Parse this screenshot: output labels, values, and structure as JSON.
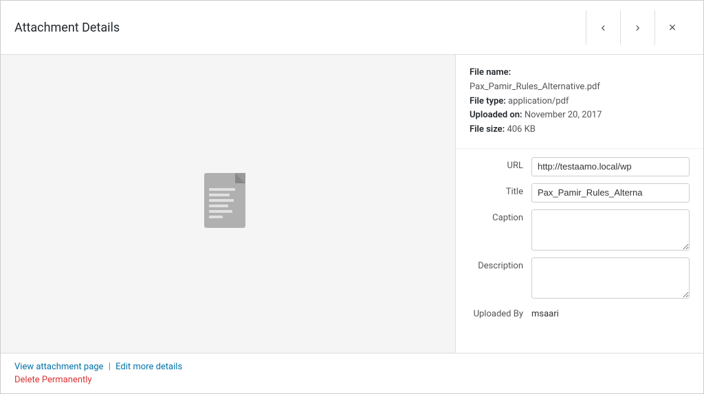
{
  "header": {
    "title": "Attachment Details",
    "prev_icon": "‹",
    "next_icon": "›",
    "close_icon": "×"
  },
  "file_info": {
    "name_label": "File name:",
    "name_value": "Pax_Pamir_Rules_Alternative.pdf",
    "type_label": "File type:",
    "type_value": "application/pdf",
    "uploaded_label": "Uploaded on:",
    "uploaded_value": "November 20, 2017",
    "size_label": "File size:",
    "size_value": "406 KB"
  },
  "form": {
    "url_label": "URL",
    "url_value": "http://testaamo.local/wp",
    "title_label": "Title",
    "title_value": "Pax_Pamir_Rules_Alterna",
    "caption_label": "Caption",
    "caption_value": "",
    "description_label": "Description",
    "description_value": "",
    "uploaded_by_label": "Uploaded By",
    "uploaded_by_value": "msaari"
  },
  "footer": {
    "view_attachment_label": "View attachment page",
    "separator1": "|",
    "edit_more_label": "Edit more details",
    "separator2": "|",
    "delete_label": "Delete Permanently"
  }
}
